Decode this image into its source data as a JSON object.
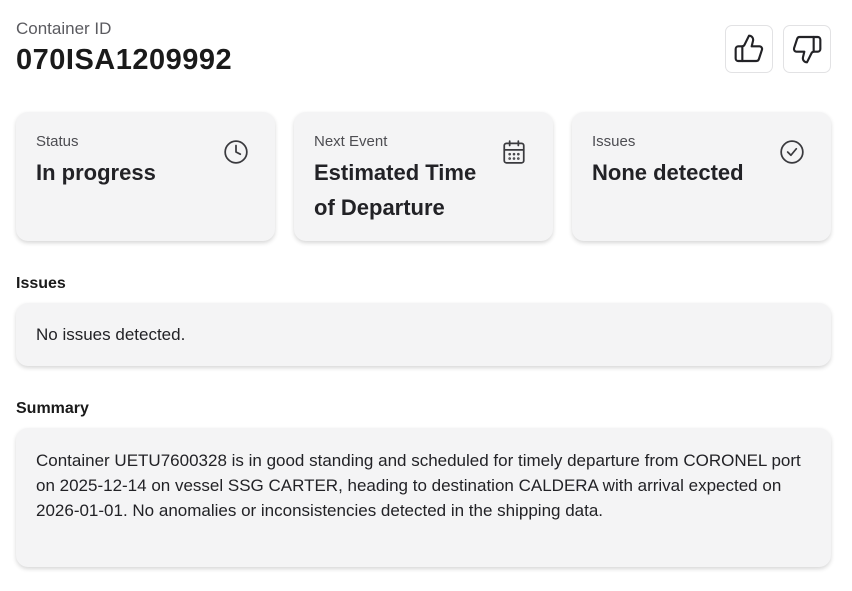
{
  "header": {
    "label": "Container ID",
    "container_id": "070ISA1209992"
  },
  "feedback": {
    "thumbs_up_icon": "thumbs-up-icon",
    "thumbs_down_icon": "thumbs-down-icon"
  },
  "cards": [
    {
      "label": "Status",
      "value": "In progress",
      "icon": "clock-icon"
    },
    {
      "label": "Next Event",
      "value": "Estimated Time of Departure",
      "icon": "calendar-icon"
    },
    {
      "label": "Issues",
      "value": "None detected",
      "icon": "check-circle-icon"
    }
  ],
  "issues": {
    "title": "Issues",
    "text": "No issues detected."
  },
  "summary": {
    "title": "Summary",
    "text": "Container UETU7600328 is in good standing and scheduled for timely departure from CORONEL port on 2025-12-14 on vessel SSG CARTER, heading to destination CALDERA with arrival expected on 2026-01-01. No anomalies or inconsistencies detected in the shipping data."
  },
  "colors": {
    "card_background": "#f4f4f5",
    "text": "#222226",
    "muted_text": "#4d4d52"
  }
}
